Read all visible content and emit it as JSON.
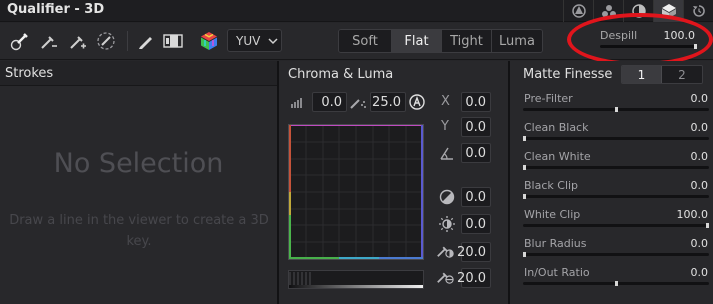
{
  "window": {
    "title": "Qualifier - 3D"
  },
  "title_icons": [
    "hsl-qualifier-icon",
    "rgb-qualifier-icon",
    "luma-qualifier-icon",
    "3d-qualifier-icon",
    "reset-icon"
  ],
  "toolbar": {
    "tools": [
      "picker-icon",
      "picker-subtract-icon",
      "picker-add-icon",
      "picker-feather-icon",
      "highlight-pen-icon",
      "highlight-toggle-icon",
      "color-cube-icon"
    ],
    "color_space": "YUV",
    "modes": [
      {
        "label": "Soft",
        "active": false
      },
      {
        "label": "Flat",
        "active": true
      },
      {
        "label": "Tight",
        "active": false
      },
      {
        "label": "Luma",
        "active": false
      }
    ],
    "despill": {
      "label": "Despill",
      "value": "100.0",
      "level": 1.0
    }
  },
  "annotation": {
    "color": "#e0151c",
    "target": "despill"
  },
  "strokes": {
    "title": "Strokes",
    "empty_title": "No Selection",
    "empty_hint": "Draw a line in the viewer to create a 3D key."
  },
  "chroma": {
    "title": "Chroma & Luma",
    "top_left": "0.0",
    "top_right": "25.0",
    "axes": [
      {
        "letter": "X",
        "value": "0.0"
      },
      {
        "letter": "Y",
        "value": "0.0"
      }
    ],
    "angle_value": "0.0",
    "adjust": [
      "0.0",
      "0.0",
      "20.0",
      "20.0"
    ]
  },
  "matte": {
    "title": "Matte Finesse",
    "tabs": [
      {
        "label": "1",
        "active": true
      },
      {
        "label": "2",
        "active": false
      }
    ],
    "rows": [
      {
        "label": "Pre-Filter",
        "value": "0.0",
        "level": 0.5
      },
      {
        "label": "Clean Black",
        "value": "0.0",
        "level": 0.0
      },
      {
        "label": "Clean White",
        "value": "0.0",
        "level": 0.0
      },
      {
        "label": "Black Clip",
        "value": "0.0",
        "level": 0.0
      },
      {
        "label": "White Clip",
        "value": "100.0",
        "level": 1.0
      },
      {
        "label": "Blur Radius",
        "value": "0.0",
        "level": 0.0
      },
      {
        "label": "In/Out Ratio",
        "value": "0.0",
        "level": 0.5
      }
    ]
  }
}
